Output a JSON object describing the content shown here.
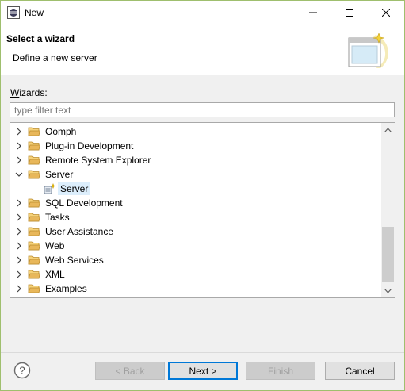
{
  "window": {
    "title": "New",
    "app_icon": "eclipse-icon",
    "controls": {
      "minimize": "minimize-icon",
      "maximize": "maximize-icon",
      "close": "close-icon"
    }
  },
  "banner": {
    "title": "Select a wizard",
    "description": "Define a new server",
    "art_icon": "new-wizard-icon"
  },
  "wizards": {
    "label_mnemonic": "W",
    "label_rest": "izards:",
    "filter_placeholder": "type filter text",
    "filter_value": "",
    "items": [
      {
        "label": "Oomph",
        "expanded": false
      },
      {
        "label": "Plug-in Development",
        "expanded": false
      },
      {
        "label": "Remote System Explorer",
        "expanded": false
      },
      {
        "label": "Server",
        "expanded": true
      },
      {
        "label": "Server",
        "child": true,
        "selected": true
      },
      {
        "label": "SQL Development",
        "expanded": false
      },
      {
        "label": "Tasks",
        "expanded": false
      },
      {
        "label": "User Assistance",
        "expanded": false
      },
      {
        "label": "Web",
        "expanded": false
      },
      {
        "label": "Web Services",
        "expanded": false
      },
      {
        "label": "XML",
        "expanded": false
      },
      {
        "label": "Examples",
        "expanded": false
      }
    ]
  },
  "footer": {
    "help_icon": "help-icon",
    "back": {
      "label": "< Back",
      "mnemonic": "B",
      "enabled": false
    },
    "next": {
      "label": "Next >",
      "mnemonic": "N",
      "enabled": true
    },
    "finish": {
      "label": "Finish",
      "mnemonic": "F",
      "enabled": false
    },
    "cancel": {
      "label": "Cancel",
      "enabled": true
    }
  },
  "colors": {
    "selection": "#dceefc",
    "folder": "#e8b75a",
    "window_border": "#9fbf6e"
  }
}
